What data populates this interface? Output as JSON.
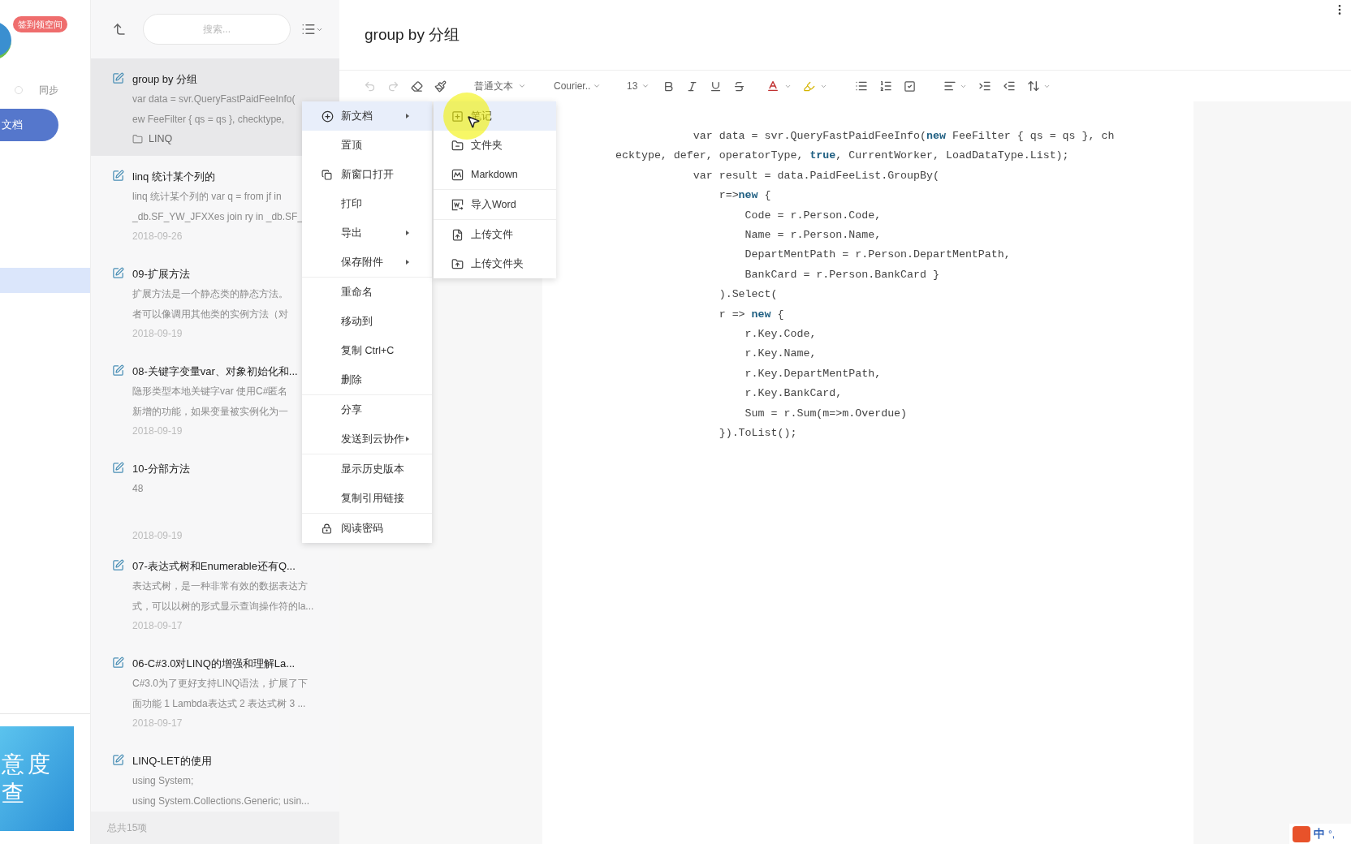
{
  "nav": {
    "badge": "签到领空间",
    "sync": "同步",
    "docs_button": "文档",
    "ad_lines": [
      "意度",
      "查"
    ]
  },
  "note_list": {
    "search": {
      "placeholder": "搜索..."
    },
    "items": [
      {
        "title": "group by 分组",
        "preview": [
          "var data = svr.QueryFastPaidFeeInfo(",
          "ew FeeFilter { qs = qs }, checktype,"
        ],
        "folder": "LINQ",
        "selected": true
      },
      {
        "title": "linq 统计某个列的",
        "preview": [
          "linq 统计某个列的 var q = from jf in",
          "_db.SF_YW_JFXXes join ry in _db.SF_"
        ],
        "date": "2018-09-26",
        "selected": false
      },
      {
        "title": "09-扩展方法",
        "preview": [
          "扩展方法是一个静态类的静态方法。",
          "者可以像调用其他类的实例方法（对"
        ],
        "date": "2018-09-19",
        "selected": false
      },
      {
        "title": "08-关键字变量var、对象初始化和...",
        "preview": [
          "隐形类型本地关键字var 使用C#匿名",
          "新增的功能，如果变量被实例化为一"
        ],
        "date": "2018-09-19",
        "selected": false
      },
      {
        "title": "10-分部方法",
        "preview": [
          "48"
        ],
        "date": "2018-09-19",
        "selected": false
      },
      {
        "title": "07-表达式树和Enumerable还有Q...",
        "preview": [
          "表达式树，是一种非常有效的数据表达方",
          "式，可以以树的形式显示查询操作符的la..."
        ],
        "date": "2018-09-17",
        "selected": false
      },
      {
        "title": "06-C#3.0对LINQ的增强和理解La...",
        "preview": [
          "C#3.0为了更好支持LINQ语法，扩展了下",
          "面功能 1 Lambda表达式 2 表达式树 3 ..."
        ],
        "date": "2018-09-17",
        "selected": false
      },
      {
        "title": "LINQ-LET的使用",
        "preview": [
          "using System;",
          "using System.Collections.Generic; usin..."
        ],
        "selected": false
      }
    ],
    "footer": "总共15项"
  },
  "editor": {
    "title": "group by 分组",
    "toolbar": {
      "paragraph_style": "普通文本",
      "font": "Courier..",
      "font_size": "13"
    },
    "code_lines": [
      "            var data = svr.QueryFastPaidFeeInfo(**new** FeeFilter { qs = qs }, ch",
      "ecktype, defer, operatorType, **true**, CurrentWorker, LoadDataType.List);",
      "            var result = data.PaidFeeList.GroupBy(",
      "                r=>**new** {",
      "                    Code = r.Person.Code,",
      "                    Name = r.Person.Name,",
      "                    DepartMentPath = r.Person.DepartMentPath,",
      "                    BankCard = r.Person.BankCard }",
      "                ).Select(",
      "                r => **new** {",
      "                    r.Key.Code,",
      "                    r.Key.Name,",
      "                    r.Key.DepartMentPath,",
      "                    r.Key.BankCard,",
      "                    Sum = r.Sum(m=>m.Overdue)",
      "                }).ToList();"
    ]
  },
  "context_menu": {
    "groups": [
      [
        {
          "label": "新文档",
          "kind": "add",
          "submenu": true,
          "selected": true
        },
        {
          "label": "置顶",
          "kind": "plain",
          "submenu": false,
          "selected": false
        },
        {
          "label": "新窗口打开",
          "kind": "window",
          "submenu": false,
          "selected": false
        },
        {
          "label": "打印",
          "kind": "plain",
          "submenu": false,
          "selected": false
        },
        {
          "label": "导出",
          "kind": "plain",
          "submenu": true,
          "selected": false
        },
        {
          "label": "保存附件",
          "kind": "plain",
          "submenu": true,
          "selected": false
        }
      ],
      [
        {
          "label": "重命名",
          "kind": "plain",
          "submenu": false,
          "selected": false
        },
        {
          "label": "移动到",
          "kind": "plain",
          "submenu": false,
          "selected": false
        },
        {
          "label": "复制 Ctrl+C",
          "kind": "plain",
          "submenu": false,
          "selected": false
        },
        {
          "label": "删除",
          "kind": "plain",
          "submenu": false,
          "selected": false
        }
      ],
      [
        {
          "label": "分享",
          "kind": "plain",
          "submenu": false,
          "selected": false
        },
        {
          "label": "发送到云协作",
          "kind": "plain",
          "submenu": true,
          "selected": false
        }
      ],
      [
        {
          "label": "显示历史版本",
          "kind": "plain",
          "submenu": false,
          "selected": false
        },
        {
          "label": "复制引用链接",
          "kind": "plain",
          "submenu": false,
          "selected": false
        }
      ],
      [
        {
          "label": "阅读密码",
          "kind": "lock",
          "submenu": false,
          "selected": false
        }
      ]
    ]
  },
  "submenu": {
    "groups": [
      [
        {
          "label": "笔记",
          "kind": "note",
          "selected": true
        },
        {
          "label": "文件夹",
          "kind": "folder",
          "selected": false
        },
        {
          "label": "Markdown",
          "kind": "markdown",
          "selected": false
        }
      ],
      [
        {
          "label": "导入Word",
          "kind": "word",
          "selected": false
        }
      ],
      [
        {
          "label": "上传文件",
          "kind": "upload",
          "selected": false
        },
        {
          "label": "上传文件夹",
          "kind": "uploadfolder",
          "selected": false
        }
      ]
    ]
  },
  "ime": {
    "label": "中",
    "extra": "°,"
  }
}
